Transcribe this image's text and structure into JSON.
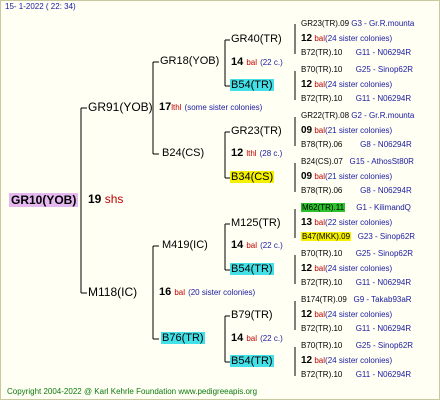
{
  "header": {
    "date": "15-   1-2022  (  22:  34)"
  },
  "footer": {
    "copyright": "Copyright 2004-2022 @ Karl Kehrle Foundation    www.pedigreeapis.org"
  },
  "root": {
    "name": "GR10(YOB)",
    "num": "19",
    "cap": "shs"
  },
  "gen1": [
    {
      "name": "GR91(YOB)",
      "num": "17",
      "cap": "lthl",
      "note": "(some sister colonies)"
    },
    {
      "name": "M118(IC)",
      "num": "16",
      "cap": "bal",
      "note": "(20 sister colonies)"
    }
  ],
  "gen2": [
    {
      "name": "GR18(YOB)"
    },
    {
      "name": "B24(CS)",
      "num": "12",
      "cap": "lthl",
      "note": "(28 c.)"
    },
    {
      "name": "M419(IC)",
      "num": "14",
      "cap": "bal",
      "note": "(22 c.)"
    },
    {
      "name": "B76(TR)"
    }
  ],
  "gen3": [
    {
      "name": "GR40(TR)",
      "num": "14",
      "cap": "bal",
      "note": "(22 c.)"
    },
    {
      "name": "B54(TR)"
    },
    {
      "name": "GR23(TR)",
      "num": "12",
      "cap": "lthl",
      "note": "(28 c.)"
    },
    {
      "name": "B34(CS)"
    },
    {
      "name": "M125(TR)",
      "num": "14",
      "cap": "bal",
      "note": "(22 c.)"
    },
    {
      "name": "B54(TR)"
    },
    {
      "name": "B79(TR)",
      "num": "14",
      "cap": "bal",
      "note": "(22 c.)"
    },
    {
      "name": "B54(TR)"
    }
  ],
  "gen4": [
    {
      "top": "GR23(TR).09",
      "topnum": "G3 - Gr.R.mounta",
      "num": "12",
      "cap": "bal",
      "note": "(24 sister colonies)",
      "bot": "B72(TR).10",
      "botnum": "G11 - N06294R"
    },
    {
      "top": "B70(TR).10",
      "topnum": "G25 - Sinop62R",
      "num": "12",
      "cap": "bal",
      "note": "(24 sister colonies)",
      "bot": "B72(TR).10",
      "botnum": "G11 - N06294R"
    },
    {
      "top": "GR22(TR).08",
      "topnum": "G2 - Gr.R.mounta",
      "num": "09",
      "cap": "bal",
      "note": "(21 sister colonies)",
      "bot": "B78(TR).06",
      "botnum": "G8 - N06294R"
    },
    {
      "top": "B24(CS).07",
      "topnum": "G15 - AthosSt80R",
      "num": "09",
      "cap": "bal",
      "note": "(21 sister colonies)",
      "bot": "B78(TR).06",
      "botnum": "G8 - N06294R"
    },
    {
      "top": "M62(TR).11",
      "topnum": "G1 - KilimandQ",
      "num": "13",
      "cap": "bal",
      "note": "(22 sister colonies)",
      "bot": "B47(MKK).09",
      "botnum": "G23 - Sinop62R"
    },
    {
      "top": "B70(TR).10",
      "topnum": "G25 - Sinop62R",
      "num": "12",
      "cap": "bal",
      "note": "(24 sister colonies)",
      "bot": "B72(TR).10",
      "botnum": "G11 - N06294R"
    },
    {
      "top": "B174(TR).09",
      "topnum": "G9 - Takab93aR",
      "num": "12",
      "cap": "bal",
      "note": "(24 sister colonies)",
      "bot": "B72(TR).10",
      "botnum": "G11 - N06294R"
    },
    {
      "top": "B70(TR).10",
      "topnum": "G25 - Sinop62R",
      "num": "12",
      "cap": "bal",
      "note": "(24 sister colonies)",
      "bot": "B72(TR).10",
      "botnum": "G11 - N06294R"
    }
  ],
  "colors": {
    "root_bg": "#e6b8f0",
    "cyan": "#44e0e8",
    "yellow": "#f4f000",
    "green": "#2dc02d",
    "red": "#c00000",
    "blue": "#1a1aa0"
  }
}
